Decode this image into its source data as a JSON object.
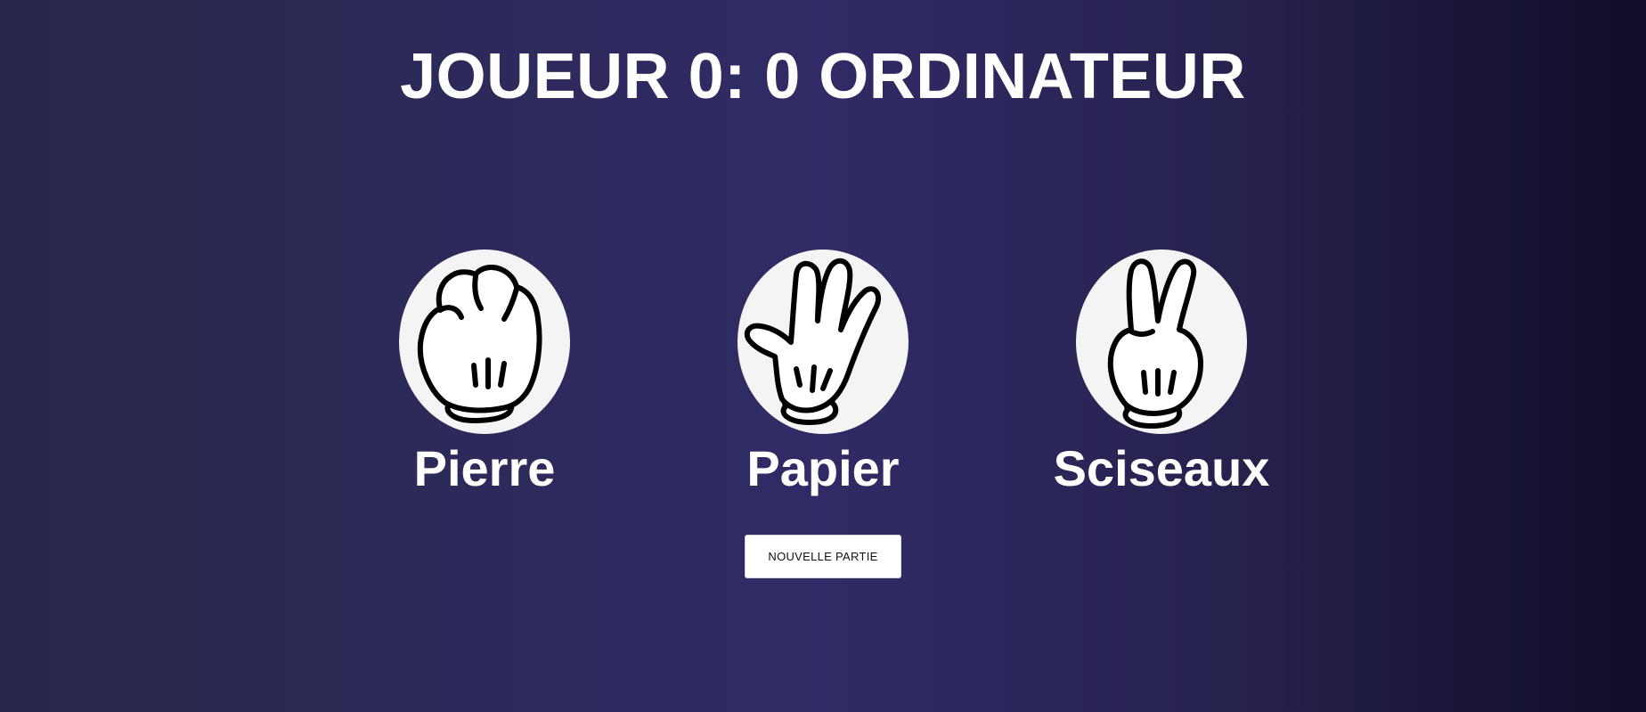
{
  "score": {
    "player_label": "JOUEUR",
    "player_score": "0",
    "separator": ":",
    "computer_score": "0",
    "computer_label": "ORDINATEUR"
  },
  "choices": [
    {
      "label": "Pierre",
      "icon": "rock-hand-icon"
    },
    {
      "label": "Papier",
      "icon": "paper-hand-icon"
    },
    {
      "label": "Sciseaux",
      "icon": "scissors-hand-icon"
    }
  ],
  "new_game_button": {
    "label": "NOUVELLE PARTIE"
  },
  "colors": {
    "background_left": "#29284a",
    "background_center": "#302b66",
    "background_right": "#0f0d27",
    "circle": "#f4f4f4",
    "text": "#ffffff"
  }
}
